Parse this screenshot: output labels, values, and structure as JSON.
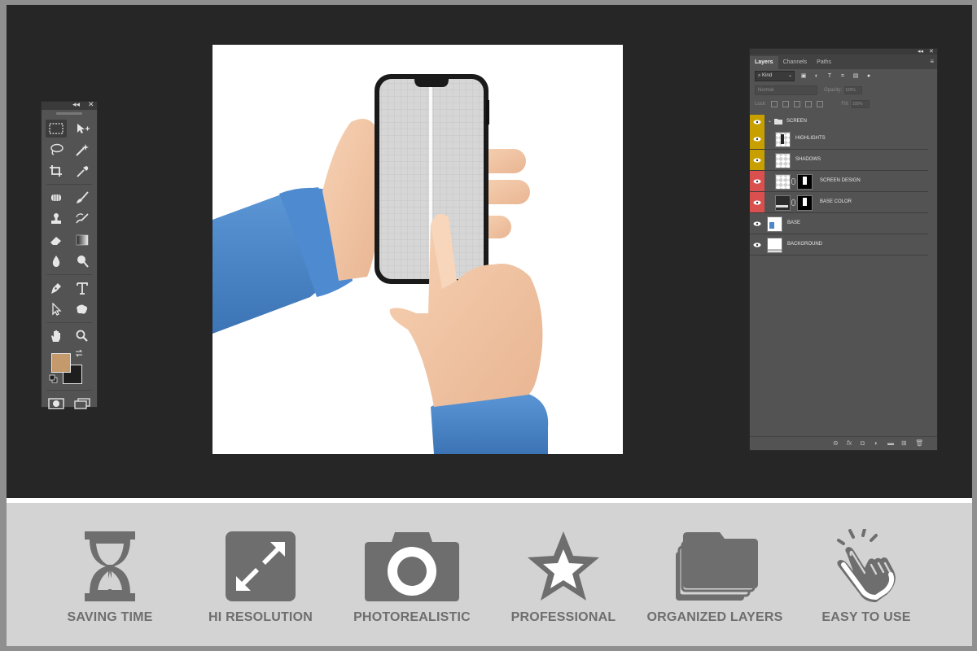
{
  "colors": {
    "workspace": "#262626",
    "panel": "#535353",
    "foreground_swatch": "#c49a6c",
    "background_swatch": "#1e1e1e",
    "sleeve": "#4a86c8",
    "skin": "#f2c7a5",
    "feature_icon": "#6e6e6e",
    "layer_tag_yellow": "#c7a000",
    "layer_tag_red": "#d9504f"
  },
  "toolbar": {
    "collapse_glyph": "◂◂",
    "close_glyph": "✕",
    "tools": [
      [
        "marquee-tool",
        "move-tool"
      ],
      [
        "lasso-tool",
        "magic-wand-tool"
      ],
      [
        "crop-tool",
        "eyedropper-tool"
      ],
      [
        "healing-brush-tool",
        "brush-tool"
      ],
      [
        "clone-stamp-tool",
        "history-brush-tool"
      ],
      [
        "eraser-tool",
        "gradient-tool"
      ],
      [
        "blur-tool",
        "dodge-tool"
      ],
      [
        "pen-tool",
        "type-tool"
      ],
      [
        "path-selection-tool",
        "custom-shape-tool"
      ],
      [
        "hand-tool",
        "zoom-tool"
      ]
    ],
    "bottom": [
      "quick-mask-icon",
      "screen-mode-icon"
    ]
  },
  "layers_panel": {
    "collapse_glyph": "◂◂",
    "close_glyph": "✕",
    "tabs": [
      "Layers",
      "Channels",
      "Paths"
    ],
    "menu_glyph": "≡",
    "filter_kind": "Kind",
    "blend_mode": "Normal",
    "opacity_label": "Opacity:",
    "opacity_value": "100%",
    "lock_label": "Lock:",
    "fill_label": "Fill:",
    "fill_value": "100%",
    "layers": [
      {
        "name": "SCREEN",
        "kind": "group",
        "tag": "yellow"
      },
      {
        "name": "HIGHLIGHTS",
        "kind": "layer",
        "tag": "yellow"
      },
      {
        "name": "SHADOWS",
        "kind": "layer",
        "tag": "yellow"
      },
      {
        "name": "SCREEN DESIGN",
        "kind": "smart-with-mask",
        "tag": "red"
      },
      {
        "name": "BASE COLOR",
        "kind": "fill-with-mask",
        "tag": "red"
      },
      {
        "name": "BASE",
        "kind": "layer",
        "tag": "none"
      },
      {
        "name": "BACKGROUND",
        "kind": "layer",
        "tag": "none"
      }
    ],
    "footer_icons": [
      "link-icon",
      "fx-icon",
      "mask-icon",
      "adjustment-icon",
      "folder-icon",
      "new-layer-icon",
      "trash-icon"
    ]
  },
  "features": [
    {
      "label": "SAVING TIME",
      "icon": "hourglass-icon"
    },
    {
      "label": "HI RESOLUTION",
      "icon": "resize-icon"
    },
    {
      "label": "PHOTOREALISTIC",
      "icon": "camera-icon"
    },
    {
      "label": "PROFESSIONAL",
      "icon": "star-icon"
    },
    {
      "label": "ORGANIZED LAYERS",
      "icon": "layers-folder-icon"
    },
    {
      "label": "EASY TO USE",
      "icon": "tap-hand-icon"
    }
  ]
}
